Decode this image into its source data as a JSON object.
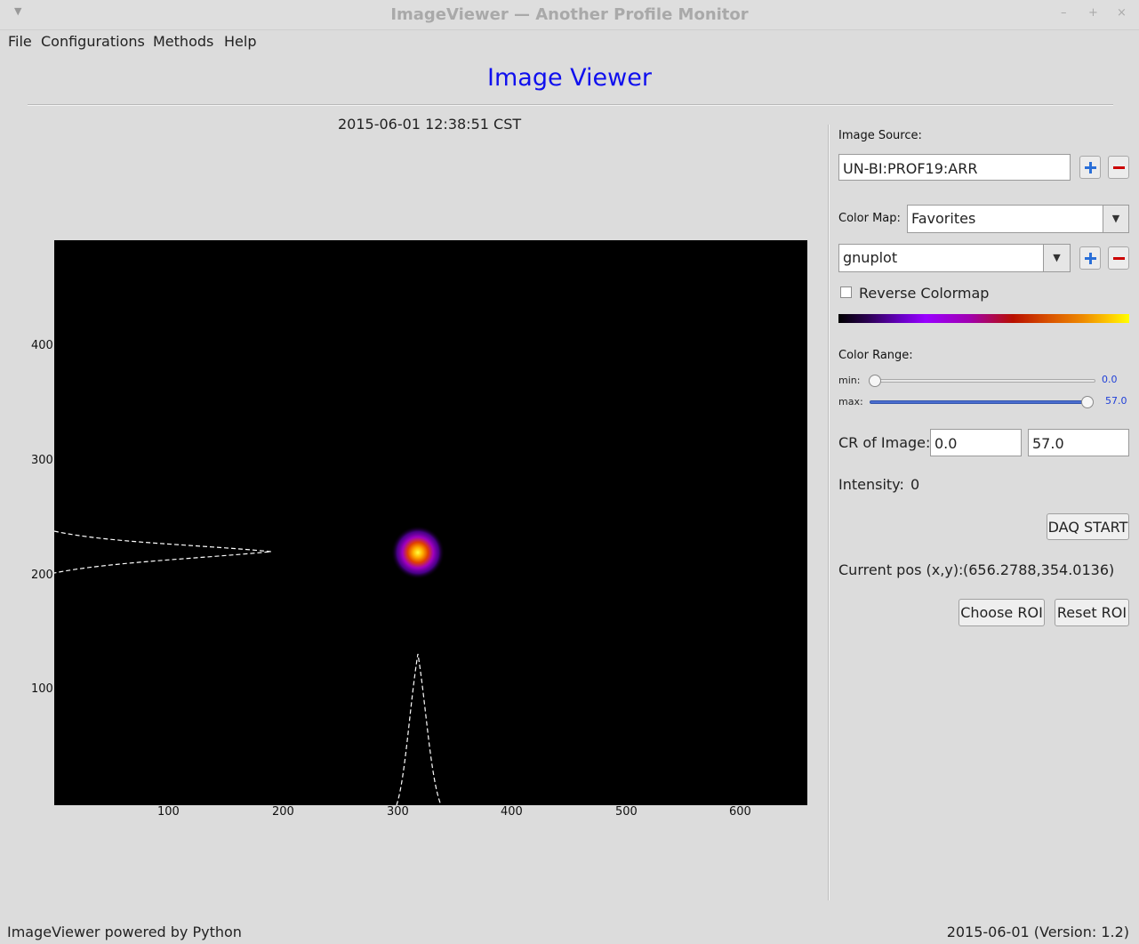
{
  "window": {
    "title": "ImageViewer — Another Profile Monitor",
    "controls": [
      "–",
      "+",
      "×"
    ]
  },
  "menu": [
    "File",
    "Configurations",
    "Methods",
    "Help"
  ],
  "heading": "Image Viewer",
  "timestamp": "2015-06-01 12:38:51 CST",
  "plot": {
    "y_ticks": [
      "400",
      "300",
      "200",
      "100"
    ],
    "x_ticks": [
      "100",
      "200",
      "300",
      "400",
      "500",
      "600"
    ],
    "xlim": [
      0,
      659
    ],
    "ylim": [
      0,
      494
    ],
    "spot_center": [
      320,
      220
    ],
    "colors": {
      "background": "#000000",
      "profile_line": "#ffffff"
    }
  },
  "panel": {
    "image_source_label": "Image Source:",
    "image_source_value": "UN-BI:PROF19:ARR",
    "color_map_label": "Color Map:",
    "color_map_category": "Favorites",
    "color_map_name": "gnuplot",
    "reverse_colormap_label": "Reverse Colormap",
    "reverse_colormap_checked": false,
    "color_range_label": "Color Range:",
    "min_label": "min:",
    "min_value": "0.0",
    "max_label": "max:",
    "max_value": "57.0",
    "min_fraction": 0.0,
    "max_fraction": 1.0,
    "cr_label": "CR of Image:",
    "cr_min": "0.0",
    "cr_max": "57.0",
    "intensity_label": "Intensity:",
    "intensity_value": "0",
    "daq_button": "DAQ START",
    "pos_label": "Current pos (x,y):",
    "pos_value": "(656.2788,354.0136)",
    "choose_roi": "Choose ROI",
    "reset_roi": "Reset ROI",
    "accent_color": "#2a6fd8",
    "remove_color": "#cc0000"
  },
  "status": {
    "left": "ImageViewer powered by Python",
    "right": "2015-06-01 (Version: 1.2)"
  }
}
